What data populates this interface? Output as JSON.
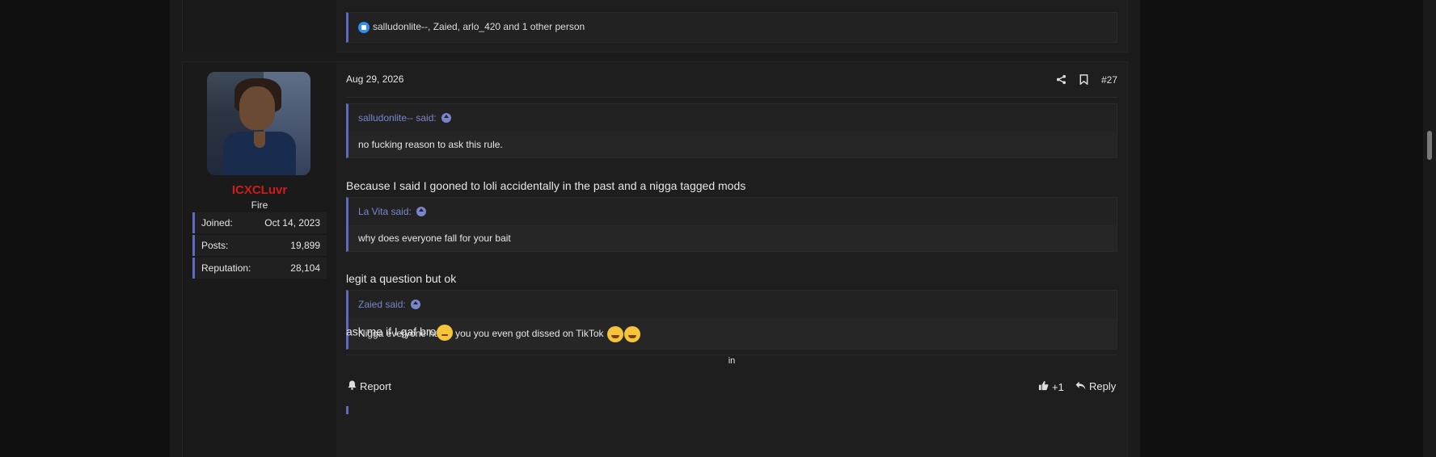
{
  "prev_post": {
    "reactions_text": "salludonlite--, Zaied, arlo_420 and 1 other person"
  },
  "post": {
    "date": "Aug 29, 2026",
    "post_number": "#27",
    "author": {
      "username": "ICXCLuvr",
      "title": "Fire",
      "username_color": "#d01c1c",
      "stats": [
        {
          "label": "Joined:",
          "value": "Oct 14, 2023"
        },
        {
          "label": "Posts:",
          "value": "19,899"
        },
        {
          "label": "Reputation:",
          "value": "28,104"
        }
      ]
    },
    "quotes": [
      {
        "author": "salludonlite-- said:",
        "text": "no fucking reason to ask this rule."
      },
      {
        "author": "La Vita said:",
        "text": "why does everyone fall for your bait"
      },
      {
        "author": "Zaied said:",
        "text": "Nigga everyone hates you you even got dissed on TikTok"
      }
    ],
    "replies": [
      "Because I said I gooned to loli accidentally in the past and a nigga tagged mods",
      "legit a question but ok",
      "ask me if I gaf bro"
    ],
    "signature": "in",
    "footer": {
      "report_label": "Report",
      "like_count": "+1",
      "reply_label": "Reply"
    }
  },
  "accent_color": "#5c6bc0",
  "quote_author_color": "#7986cb"
}
